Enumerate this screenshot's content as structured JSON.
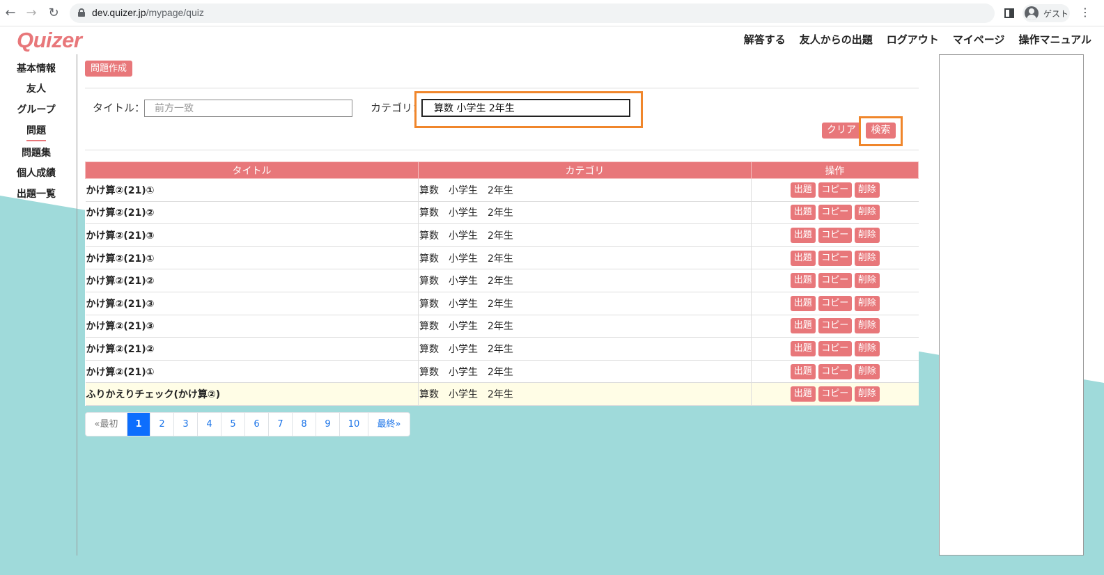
{
  "browser": {
    "url_host": "dev.quizer.jp",
    "url_path": "/mypage/quiz",
    "profile_label": "ゲスト",
    "back_icon": "←",
    "forward_icon": "→",
    "reload_icon": "↻",
    "menu_icon": "⋮"
  },
  "app": {
    "logo": "Quizer",
    "brand_color": "#e8777a",
    "highlight_color": "#f0862b",
    "bg_accent_color": "#9fdada"
  },
  "top_nav": [
    "解答する",
    "友人からの出題",
    "ログアウト",
    "マイページ",
    "操作マニュアル"
  ],
  "sidebar": {
    "items": [
      {
        "label": "基本情報"
      },
      {
        "label": "友人"
      },
      {
        "label": "グループ"
      },
      {
        "label": "問題",
        "active": true
      },
      {
        "label": "問題集"
      },
      {
        "label": "個人成績"
      },
      {
        "label": "出題一覧"
      }
    ]
  },
  "main": {
    "create_button": "問題作成",
    "search": {
      "title_label": "タイトル：",
      "title_placeholder": "前方一致",
      "category_label": "カテゴリ：",
      "category_value": "算数 小学生 2年生",
      "clear_button": "クリア",
      "search_button": "検索"
    },
    "table": {
      "headers": [
        "タイトル",
        "カテゴリ",
        "操作"
      ],
      "op_labels": {
        "issue": "出題",
        "copy": "コピー",
        "delete": "削除"
      },
      "rows": [
        {
          "title": "かけ算②(21)①",
          "category": "算数　小学生　2年生"
        },
        {
          "title": "かけ算②(21)②",
          "category": "算数　小学生　2年生"
        },
        {
          "title": "かけ算②(21)③",
          "category": "算数　小学生　2年生"
        },
        {
          "title": "かけ算②(21)①",
          "category": "算数　小学生　2年生"
        },
        {
          "title": "かけ算②(21)②",
          "category": "算数　小学生　2年生"
        },
        {
          "title": "かけ算②(21)③",
          "category": "算数　小学生　2年生"
        },
        {
          "title": "かけ算②(21)③",
          "category": "算数　小学生　2年生"
        },
        {
          "title": "かけ算②(21)②",
          "category": "算数　小学生　2年生"
        },
        {
          "title": "かけ算②(21)①",
          "category": "算数　小学生　2年生"
        },
        {
          "title": "ふりかえりチェック(かけ算②)",
          "category": "算数　小学生　2年生"
        }
      ]
    },
    "pagination": {
      "first": "«最初",
      "pages": [
        "1",
        "2",
        "3",
        "4",
        "5",
        "6",
        "7",
        "8",
        "9",
        "10"
      ],
      "current": "1",
      "last": "最終»"
    }
  }
}
